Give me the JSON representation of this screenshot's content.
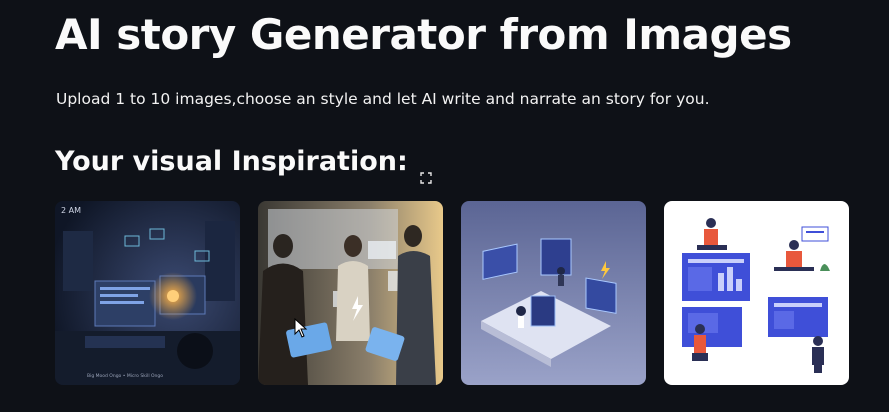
{
  "header": {
    "title": "AI story Generator from Images",
    "subtitle": "Upload 1 to 10 images,choose an style and let AI write and narrate an story for you."
  },
  "gallery": {
    "heading": "Your visual Inspiration:",
    "fullscreen_icon": "fullscreen-icon",
    "images": [
      {
        "top_caption": "2 AM",
        "bottom_caption": "Big Mood Ongo • Micro Skill Ongo"
      },
      {},
      {},
      {}
    ]
  },
  "colors": {
    "background": "#0e1117",
    "text": "#fafafa"
  }
}
